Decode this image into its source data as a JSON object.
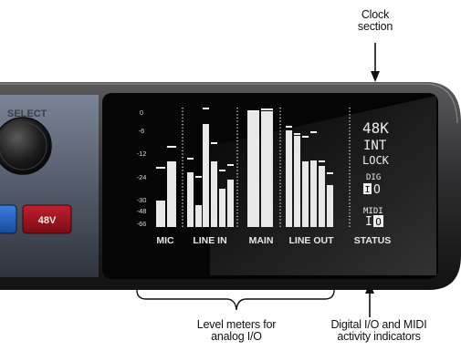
{
  "callouts": {
    "clock_section": [
      "Clock",
      "section"
    ],
    "level_meters": [
      "Level meters for",
      "analog I/O"
    ],
    "digital_midi": [
      "Digital I/O and MIDI",
      "activity indicators"
    ]
  },
  "device": {
    "select_label": "SELECT",
    "phantom_button_label": "48V",
    "scale_labels": [
      "0",
      "-6",
      "-12",
      "-24",
      "-30",
      "-48",
      "-66"
    ],
    "meter_group_labels": [
      "MIC",
      "LINE IN",
      "MAIN",
      "LINE OUT",
      "STATUS"
    ],
    "status": {
      "sample_rate": "48K",
      "clock_source": "INT",
      "lock": "LOCK",
      "dig_label": "DIG",
      "dig_in": "I",
      "dig_out": "O",
      "midi_label": "MIDI",
      "midi_in": "I",
      "midi_out": "O"
    }
  },
  "meters": {
    "mic": [
      {
        "level": 0.22,
        "peak": 0.5
      },
      {
        "level": 0.55,
        "peak": 0.68
      }
    ],
    "line_in": [
      {
        "level": 0.46,
        "peak": 0.58
      },
      {
        "level": 0.18,
        "peak": 0.43
      },
      {
        "level": 0.86,
        "peak": 1.0
      },
      {
        "level": 0.55,
        "peak": 0.71
      },
      {
        "level": 0.32,
        "peak": 0.48
      },
      {
        "level": 0.4,
        "peak": 0.53
      }
    ],
    "main": [
      {
        "level": 0.96,
        "peak": 0.98
      },
      {
        "level": 0.97,
        "peak": 0.99
      }
    ],
    "line_out": [
      {
        "level": 0.81,
        "peak": 0.85
      },
      {
        "level": 0.76,
        "peak": 0.79
      },
      {
        "level": 0.55,
        "peak": 0.76
      },
      {
        "level": 0.56,
        "peak": 0.8
      },
      {
        "level": 0.51,
        "peak": 0.56
      },
      {
        "level": 0.35,
        "peak": 0.46
      }
    ]
  }
}
